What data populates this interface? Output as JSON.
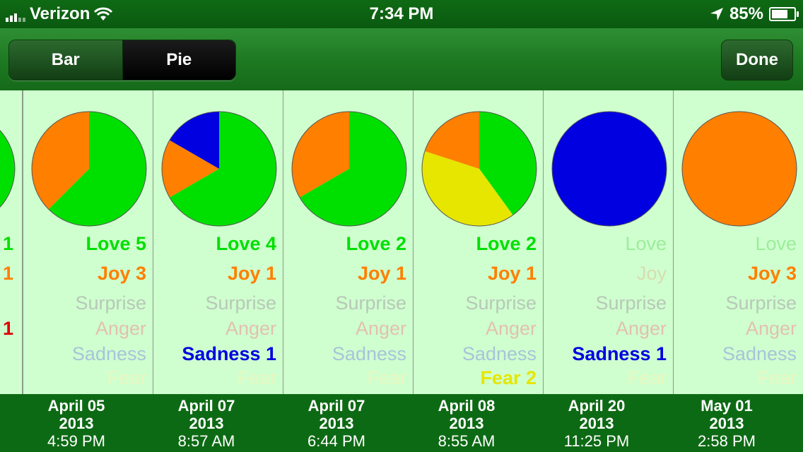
{
  "status_bar": {
    "carrier": "Verizon",
    "time": "7:34 PM",
    "battery_percent": "85%",
    "battery_level": 0.85
  },
  "toolbar": {
    "segments": [
      {
        "label": "Bar",
        "selected": false
      },
      {
        "label": "Pie",
        "selected": true
      }
    ],
    "done_label": "Done"
  },
  "colors": {
    "Love": "#00e000",
    "Joy": "#ff7f00",
    "Surprise": "#a0a0a0",
    "Anger": "#e00000",
    "Sadness": "#0000e0",
    "Fear": "#e6e600",
    "Love_dim": "#9cec9c",
    "Joy_dim": "#d8dcb0",
    "Surprise_dim": "#b8c8b8",
    "Anger_dim": "#e2c0b0",
    "Sadness_dim": "#a8c4d8",
    "Fear_dim": "#eaf6c0"
  },
  "partial_column": {
    "values": [
      "1",
      "1",
      "1"
    ]
  },
  "entries": [
    {
      "date": "April 05",
      "year": "2013",
      "time": "4:59 PM",
      "emotions": [
        {
          "name": "Love",
          "count": 5
        },
        {
          "name": "Joy",
          "count": 3
        },
        {
          "name": "Surprise",
          "count": 0
        },
        {
          "name": "Anger",
          "count": 0
        },
        {
          "name": "Sadness",
          "count": 0
        },
        {
          "name": "Fear",
          "count": 0
        }
      ]
    },
    {
      "date": "April 07",
      "year": "2013",
      "time": "8:57 AM",
      "emotions": [
        {
          "name": "Love",
          "count": 4
        },
        {
          "name": "Joy",
          "count": 1
        },
        {
          "name": "Surprise",
          "count": 0
        },
        {
          "name": "Anger",
          "count": 0
        },
        {
          "name": "Sadness",
          "count": 1
        },
        {
          "name": "Fear",
          "count": 0
        }
      ]
    },
    {
      "date": "April 07",
      "year": "2013",
      "time": "6:44 PM",
      "emotions": [
        {
          "name": "Love",
          "count": 2
        },
        {
          "name": "Joy",
          "count": 1
        },
        {
          "name": "Surprise",
          "count": 0
        },
        {
          "name": "Anger",
          "count": 0
        },
        {
          "name": "Sadness",
          "count": 0
        },
        {
          "name": "Fear",
          "count": 0
        }
      ]
    },
    {
      "date": "April 08",
      "year": "2013",
      "time": "8:55 AM",
      "emotions": [
        {
          "name": "Love",
          "count": 2
        },
        {
          "name": "Joy",
          "count": 1
        },
        {
          "name": "Surprise",
          "count": 0
        },
        {
          "name": "Anger",
          "count": 0
        },
        {
          "name": "Sadness",
          "count": 0
        },
        {
          "name": "Fear",
          "count": 2
        }
      ]
    },
    {
      "date": "April 20",
      "year": "2013",
      "time": "11:25 PM",
      "emotions": [
        {
          "name": "Love",
          "count": 0
        },
        {
          "name": "Joy",
          "count": 0
        },
        {
          "name": "Surprise",
          "count": 0
        },
        {
          "name": "Anger",
          "count": 0
        },
        {
          "name": "Sadness",
          "count": 1
        },
        {
          "name": "Fear",
          "count": 0
        }
      ]
    },
    {
      "date": "May 01",
      "year": "2013",
      "time": "2:58 PM",
      "emotions": [
        {
          "name": "Love",
          "count": 0
        },
        {
          "name": "Joy",
          "count": 3
        },
        {
          "name": "Surprise",
          "count": 0
        },
        {
          "name": "Anger",
          "count": 0
        },
        {
          "name": "Sadness",
          "count": 0
        },
        {
          "name": "Fear",
          "count": 0
        }
      ]
    }
  ]
}
